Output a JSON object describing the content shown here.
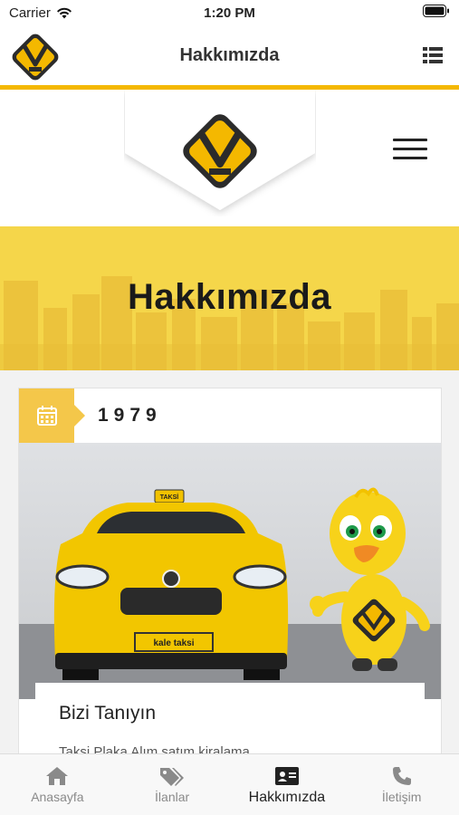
{
  "status_bar": {
    "carrier": "Carrier",
    "time": "1:20 PM"
  },
  "app_header": {
    "title": "Hakkımızda"
  },
  "banner": {
    "title": "Hakkımızda"
  },
  "timeline": {
    "year": "1979",
    "photo": {
      "taxi_roof_sign": "TAKSİ",
      "plate_text": "kale taksi"
    },
    "section_title": "Bizi Tanıyın",
    "body_text": "Taksi Plaka Alım satım kiralama ..."
  },
  "tabs": [
    {
      "label": "Anasayfa",
      "icon": "home-icon"
    },
    {
      "label": "İlanlar",
      "icon": "tags-icon"
    },
    {
      "label": "Hakkımızda",
      "icon": "id-card-icon",
      "active": true
    },
    {
      "label": "İletişim",
      "icon": "phone-icon"
    }
  ],
  "colors": {
    "brand_yellow": "#f4b800",
    "banner_yellow": "#f5d64a",
    "date_box": "#f4c74a",
    "logo_dark": "#2b2b2b"
  }
}
